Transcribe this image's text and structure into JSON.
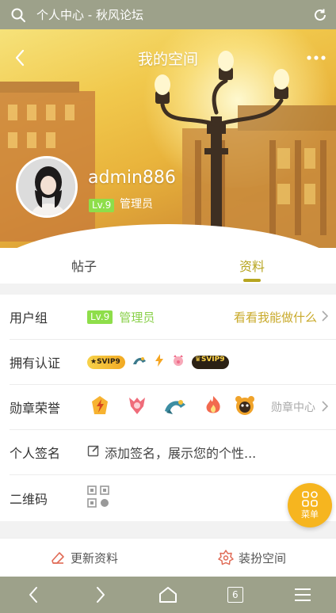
{
  "browser": {
    "title": "个人中心 - 秋风论坛",
    "tab_count": "6"
  },
  "hero": {
    "title": "我的空间",
    "username": "admin886",
    "level": "Lv.9",
    "role": "管理员"
  },
  "tabs": [
    {
      "label": "帖子",
      "active": false
    },
    {
      "label": "资料",
      "active": true
    }
  ],
  "info": {
    "group": {
      "label": "用户组",
      "level": "Lv.9",
      "role": "管理员",
      "action": "看看我能做什么"
    },
    "certs": {
      "label": "拥有认证",
      "badge1": "SVIP9",
      "badge2": "SVIP9"
    },
    "medals": {
      "label": "勋章荣誉",
      "link": "勋章中心"
    },
    "signature": {
      "label": "个人签名",
      "text": "添加签名，展示您的个性..."
    },
    "qrcode": {
      "label": "二维码"
    }
  },
  "fab": {
    "label": "菜单"
  },
  "actions": {
    "update": "更新资料",
    "decorate": "装扮空间"
  },
  "colors": {
    "browser_bar": "#9da18a",
    "accent": "#b7a520",
    "green": "#8ad04a",
    "gold": "#c9aa2b",
    "fab": "#f6b51f"
  }
}
